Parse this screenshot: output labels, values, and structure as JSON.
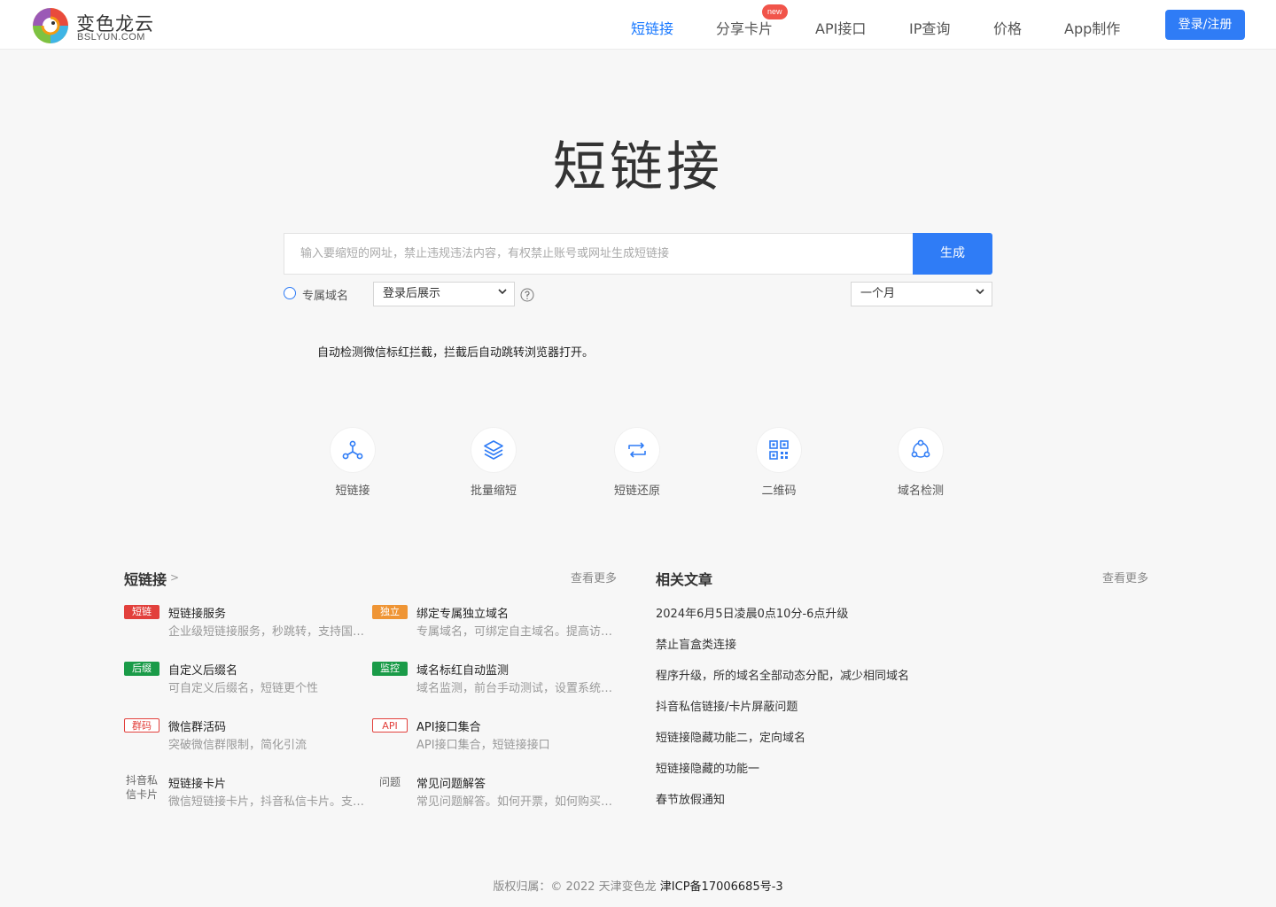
{
  "brand": {
    "name_cn": "变色龙云",
    "name_en": "BSLYUN.COM"
  },
  "nav": {
    "items": [
      {
        "label": "短链接",
        "active": true
      },
      {
        "label": "分享卡片",
        "badge": "new"
      },
      {
        "label": "API接口"
      },
      {
        "label": "IP查询"
      },
      {
        "label": "价格"
      },
      {
        "label": "App制作"
      }
    ],
    "login_label": "登录/注册"
  },
  "hero": {
    "title": "短链接",
    "input_placeholder": "输入要缩短的网址，禁止违规违法内容，有权禁止账号或网址生成短链接",
    "generate_label": "生成",
    "domain_option_label": "专属域名",
    "display_select_value": "登录后展示",
    "period_select_value": "一个月",
    "notice": "自动检测微信标红拦截，拦截后自动跳转浏览器打开。"
  },
  "tools": [
    {
      "label": "短链接",
      "icon": "share-nodes-icon"
    },
    {
      "label": "批量缩短",
      "icon": "layers-icon"
    },
    {
      "label": "短链还原",
      "icon": "repeat-icon"
    },
    {
      "label": "二维码",
      "icon": "qrcode-icon"
    },
    {
      "label": "域名检测",
      "icon": "network-triangle-icon"
    }
  ],
  "services_section": {
    "title": "短链接",
    "arrow": ">",
    "more_label": "查看更多",
    "items": [
      {
        "tag": "短链",
        "tag_color": "#e2403c",
        "tag_style": "solid",
        "title": "短链接服务",
        "desc": "企业级短链接服务，秒跳转，支持国内外高速访问"
      },
      {
        "tag": "独立",
        "tag_color": "#ef9535",
        "tag_style": "solid",
        "title": "绑定专属独立域名",
        "desc": "专属域名，可绑定自主域名。提高访问稳定性"
      },
      {
        "tag": "后缀",
        "tag_color": "#1a9b48",
        "tag_style": "solid",
        "title": "自定义后缀名",
        "desc": "可自定义后缀名，短链更个性"
      },
      {
        "tag": "监控",
        "tag_color": "#1a9b48",
        "tag_style": "solid",
        "title": "域名标红自动监测",
        "desc": "域名监测，前台手动测试，设置系统自动检测"
      },
      {
        "tag": "群码",
        "tag_color": "#e2403c",
        "tag_style": "outline",
        "title": "微信群活码",
        "desc": "突破微信群限制，简化引流"
      },
      {
        "tag": "API",
        "tag_color": "#e2403c",
        "tag_style": "outline",
        "title": "API接口集合",
        "desc": "API接口集合，短链接接口"
      },
      {
        "tag": "抖音私信卡片",
        "tag_color": "#666666",
        "tag_style": "plain",
        "title": "短链接卡片",
        "desc": "微信短链接卡片，抖音私信卡片。支持自定义"
      },
      {
        "tag": "问题",
        "tag_color": "#666666",
        "tag_style": "plain",
        "title": "常见问题解答",
        "desc": "常见问题解答。如何开票，如何购买套餐"
      }
    ]
  },
  "articles_section": {
    "title": "相关文章",
    "more_label": "查看更多",
    "items": [
      "2024年6月5日凌晨0点10分-6点升级",
      "禁止盲盒类连接",
      "程序升级，所的域名全部动态分配，减少相同域名",
      "抖音私信链接/卡片屏蔽问题",
      "短链接隐藏功能二，定向域名",
      "短链接隐藏的功能一",
      "春节放假通知"
    ]
  },
  "footer": {
    "copyright": "版权归属：© 2022 天津变色龙 ",
    "icp": "津ICP备17006685号-3"
  },
  "colors": {
    "accent": "#2f7cf6",
    "active_nav": "#1677ff",
    "badge": "#f1544a",
    "background": "#f7f7f7"
  }
}
